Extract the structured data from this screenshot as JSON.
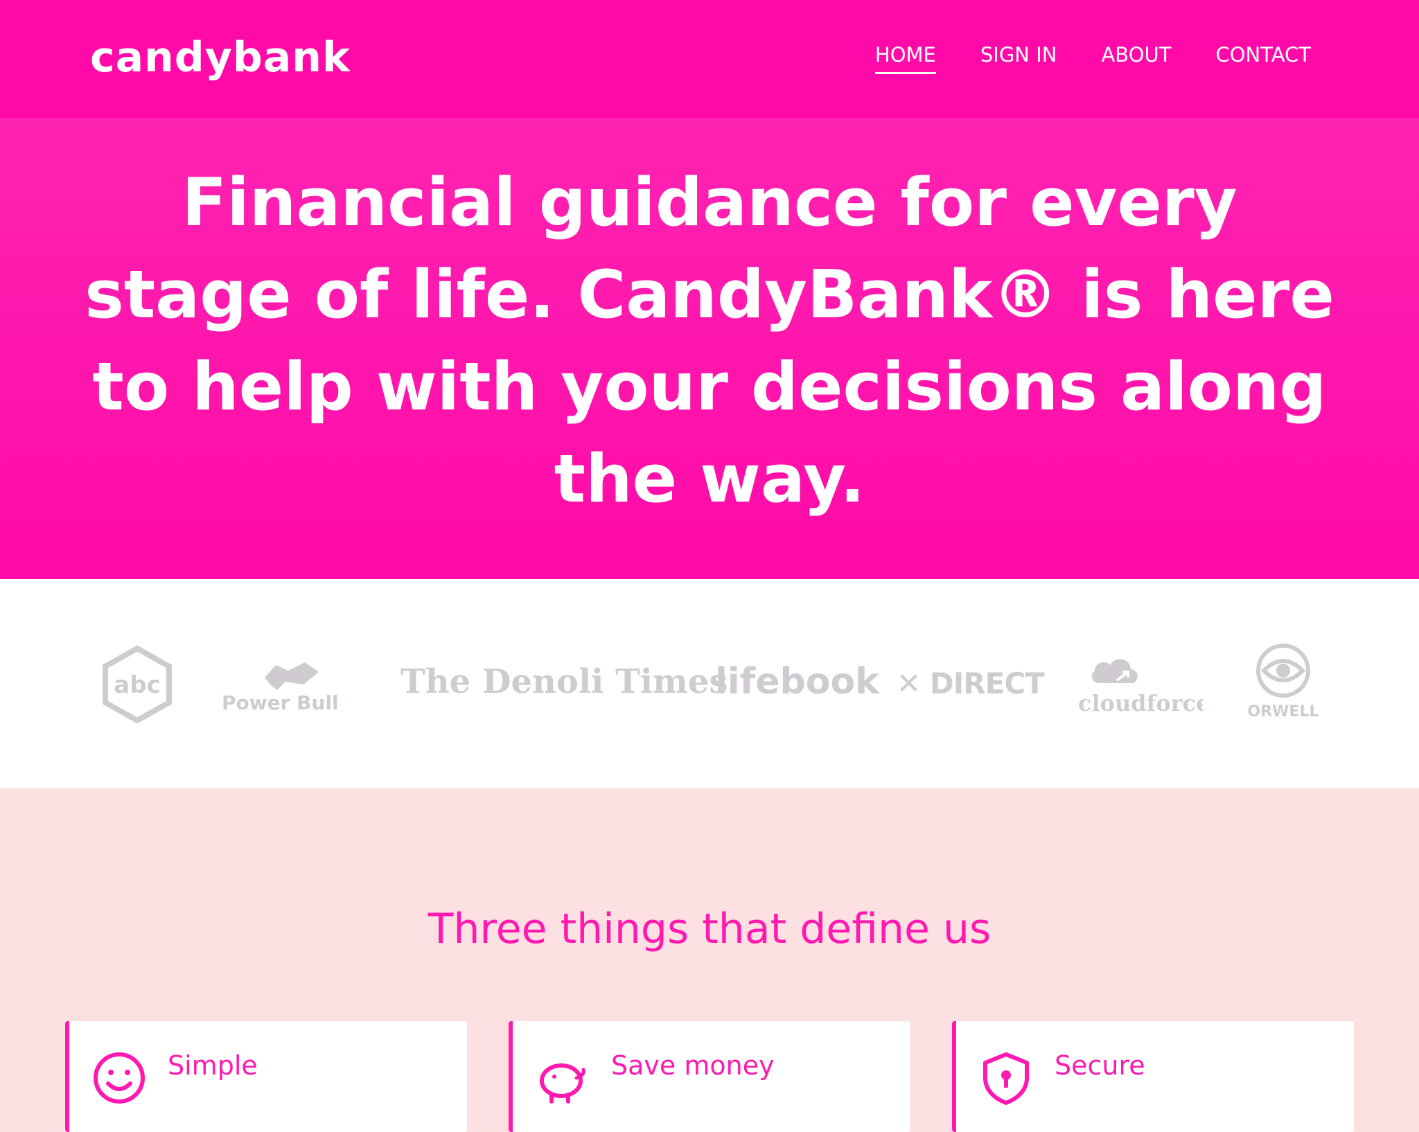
{
  "header": {
    "logo": "candybank",
    "nav": [
      {
        "label": "HOME",
        "active": true
      },
      {
        "label": "SIGN IN",
        "active": false
      },
      {
        "label": "ABOUT",
        "active": false
      },
      {
        "label": "CONTACT",
        "active": false
      }
    ]
  },
  "hero": {
    "headline": "Financial guidance for every stage of life. CandyBank® is here to help with your decisions along the way."
  },
  "brands": {
    "abc": "abc",
    "power_bull": "Power Bull",
    "times": "The Denoli Times",
    "lifebook": "lifebook",
    "direct": "✕ DIRECT",
    "cloudforce": "cloudforce",
    "orwell": "ORWELL"
  },
  "features": {
    "title": "Three things that define us",
    "cards": [
      {
        "label": "Simple",
        "icon": "smiley-icon"
      },
      {
        "label": "Save money",
        "icon": "piggy-bank-icon"
      },
      {
        "label": "Secure",
        "icon": "shield-lock-icon"
      }
    ]
  },
  "colors": {
    "brand_pink": "#ff0aa8",
    "accent_pink": "#ff19b0",
    "features_bg": "#fde0e1",
    "logo_gray": "#cfcbd1"
  }
}
